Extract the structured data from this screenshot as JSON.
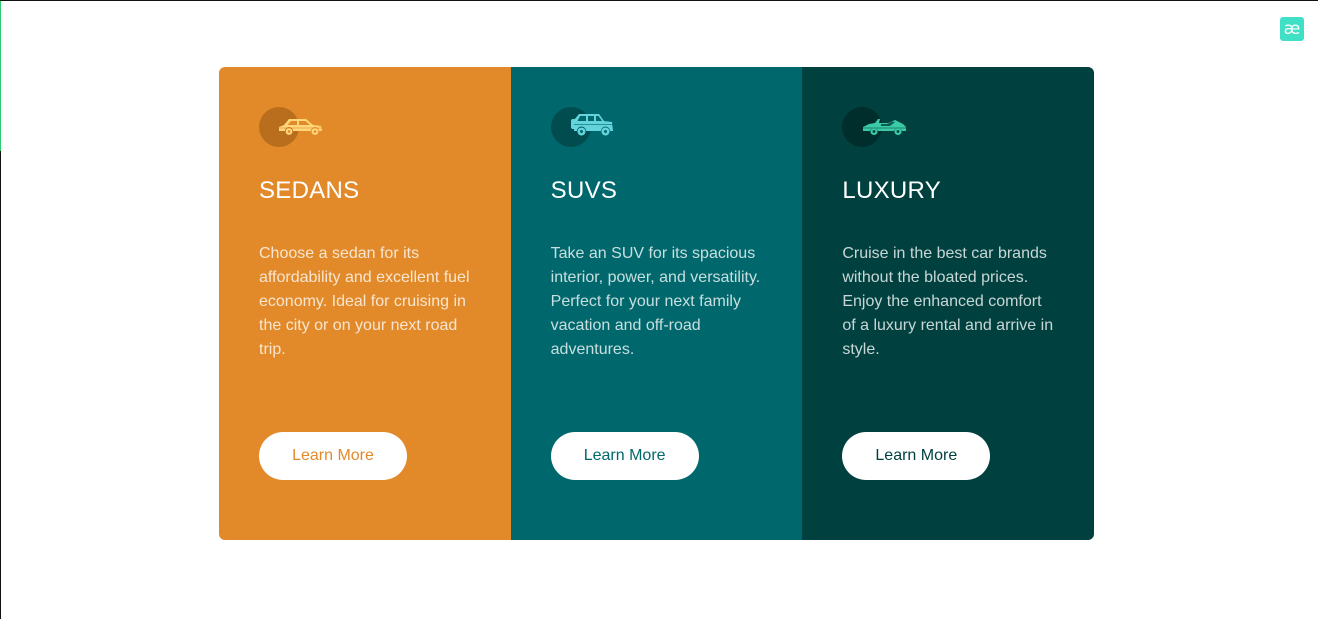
{
  "corner_logo": {
    "glyph": "æ",
    "color": "#3fe0c5"
  },
  "cards": [
    {
      "id": "sedans",
      "icon": "sedan-car-icon",
      "title": "SEDANS",
      "description": "Choose a sedan for its affordability and excellent fuel economy. Ideal for cruising in the city or on your next road trip.",
      "button_label": "Learn More",
      "bg_color": "#e28a2a",
      "icon_color": "#ffd67a",
      "icon_circle_color": "#b86e1c",
      "button_text_color": "#e28a2a"
    },
    {
      "id": "suvs",
      "icon": "suv-car-icon",
      "title": "SUVS",
      "description": "Take an SUV for its spacious interior, power, and versatility. Perfect for your next family vacation and off-road adventures.",
      "button_label": "Learn More",
      "bg_color": "#00686c",
      "icon_color": "#63d3dc",
      "icon_circle_color": "#004c4f",
      "button_text_color": "#00686c"
    },
    {
      "id": "luxury",
      "icon": "luxury-car-icon",
      "title": "LUXURY",
      "description": "Cruise in the best car brands without the bloated prices. Enjoy the enhanced comfort of a luxury rental and arrive in style.",
      "button_label": "Learn More",
      "bg_color": "#004140",
      "icon_color": "#3cc9a5",
      "icon_circle_color": "#002e2d",
      "button_text_color": "#004140"
    }
  ]
}
